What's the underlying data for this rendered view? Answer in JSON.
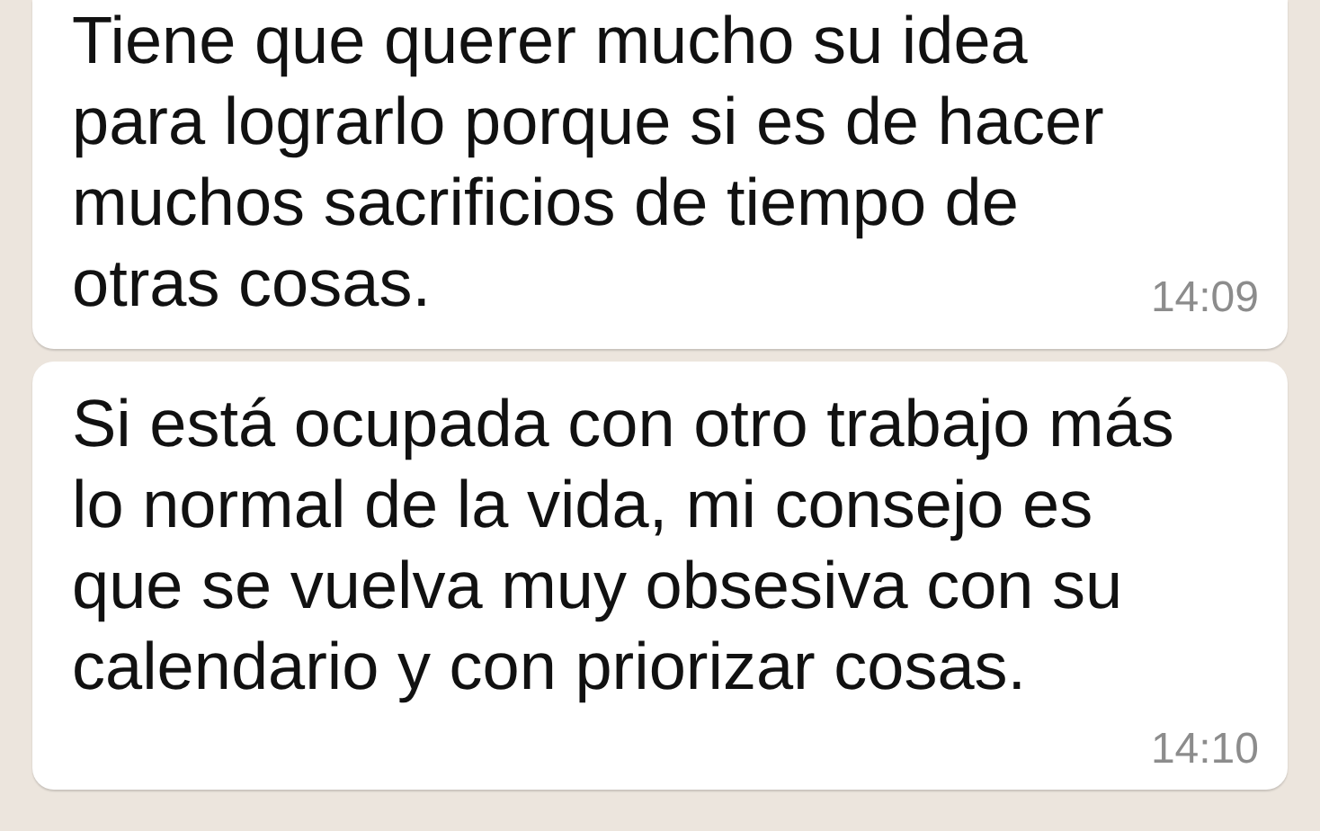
{
  "messages": [
    {
      "text": "Tiene que querer mucho su idea\npara lograrlo porque si es de hacer\nmuchos sacrificios de tiempo de\notras cosas.",
      "time": "14:09"
    },
    {
      "text": "Si está ocupada con otro trabajo más\nlo normal de la vida, mi consejo es\nque se vuelva muy obsesiva con su\ncalendario y con priorizar cosas.",
      "time": "14:10"
    }
  ]
}
